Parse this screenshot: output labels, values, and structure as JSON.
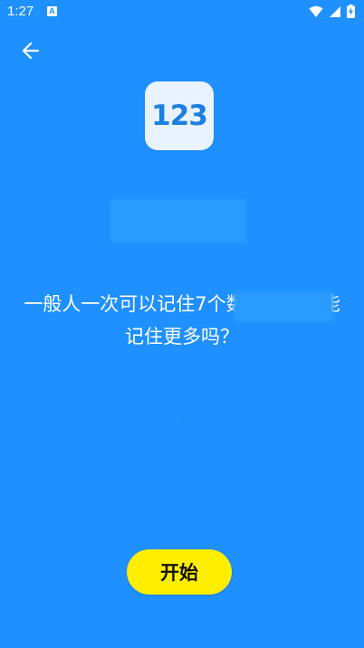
{
  "status_bar": {
    "time": "1:27",
    "notification_glyph": "A",
    "icons": [
      "wifi-icon",
      "signal-icon",
      "battery-charging-icon"
    ]
  },
  "header": {
    "back_icon": "arrow-left-icon"
  },
  "app_icon": {
    "text": "123"
  },
  "main": {
    "description": "一般人一次可以记住7个数字母。你能记住更多吗？"
  },
  "footer": {
    "start_label": "开始"
  },
  "colors": {
    "background": "#1e90ff",
    "accent_button": "#ffee00",
    "icon_tile": "#e8f3ff",
    "icon_text": "#1d7fe0"
  }
}
